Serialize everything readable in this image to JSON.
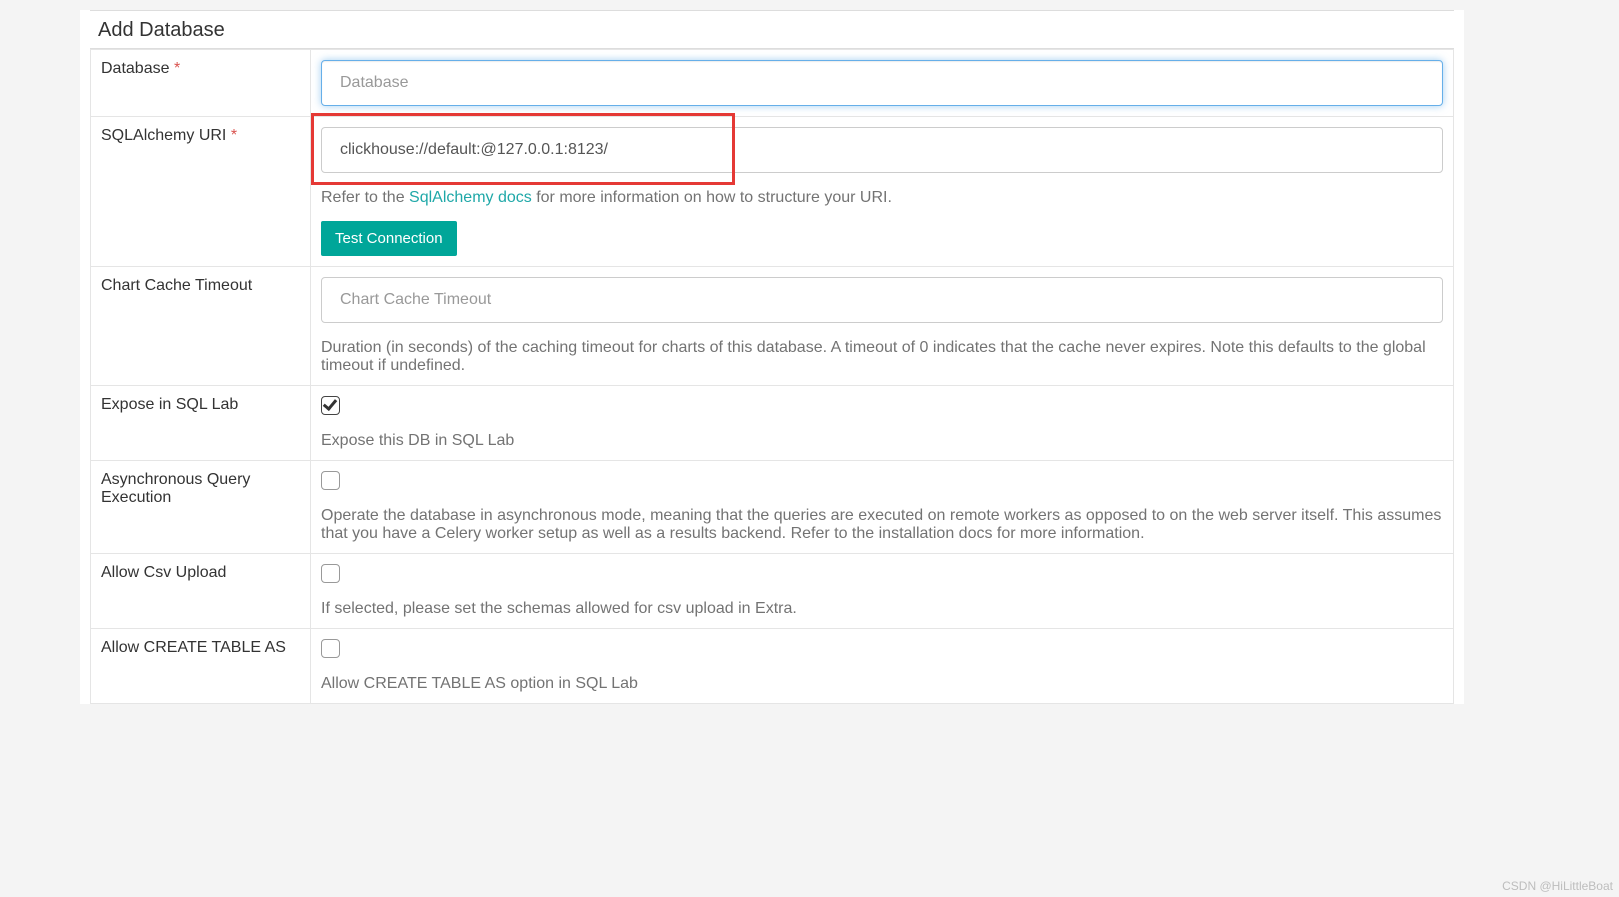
{
  "page": {
    "title": "Add Database"
  },
  "fields": {
    "database": {
      "label": "Database",
      "required": "*",
      "placeholder": "Database",
      "value": ""
    },
    "sqlalchemy_uri": {
      "label": "SQLAlchemy URI",
      "required": "*",
      "value": "clickhouse://default:@127.0.0.1:8123/",
      "help_prefix": "Refer to the ",
      "help_link_text": "SqlAlchemy docs",
      "help_suffix": " for more information on how to structure your URI.",
      "test_button": "Test Connection"
    },
    "chart_cache_timeout": {
      "label": "Chart Cache Timeout",
      "placeholder": "Chart Cache Timeout",
      "value": "",
      "help": "Duration (in seconds) of the caching timeout for charts of this database. A timeout of 0 indicates that the cache never expires. Note this defaults to the global timeout if undefined."
    },
    "expose_in_sql_lab": {
      "label": "Expose in SQL Lab",
      "checked": true,
      "help": "Expose this DB in SQL Lab"
    },
    "async_query": {
      "label": "Asynchronous Query Execution",
      "checked": false,
      "help": "Operate the database in asynchronous mode, meaning that the queries are executed on remote workers as opposed to on the web server itself. This assumes that you have a Celery worker setup as well as a results backend. Refer to the installation docs for more information."
    },
    "allow_csv_upload": {
      "label": "Allow Csv Upload",
      "checked": false,
      "help": "If selected, please set the schemas allowed for csv upload in Extra."
    },
    "allow_create_table_as": {
      "label": "Allow CREATE TABLE AS",
      "checked": false,
      "help": "Allow CREATE TABLE AS option in SQL Lab"
    }
  },
  "watermark": "CSDN @HiLittleBoat"
}
